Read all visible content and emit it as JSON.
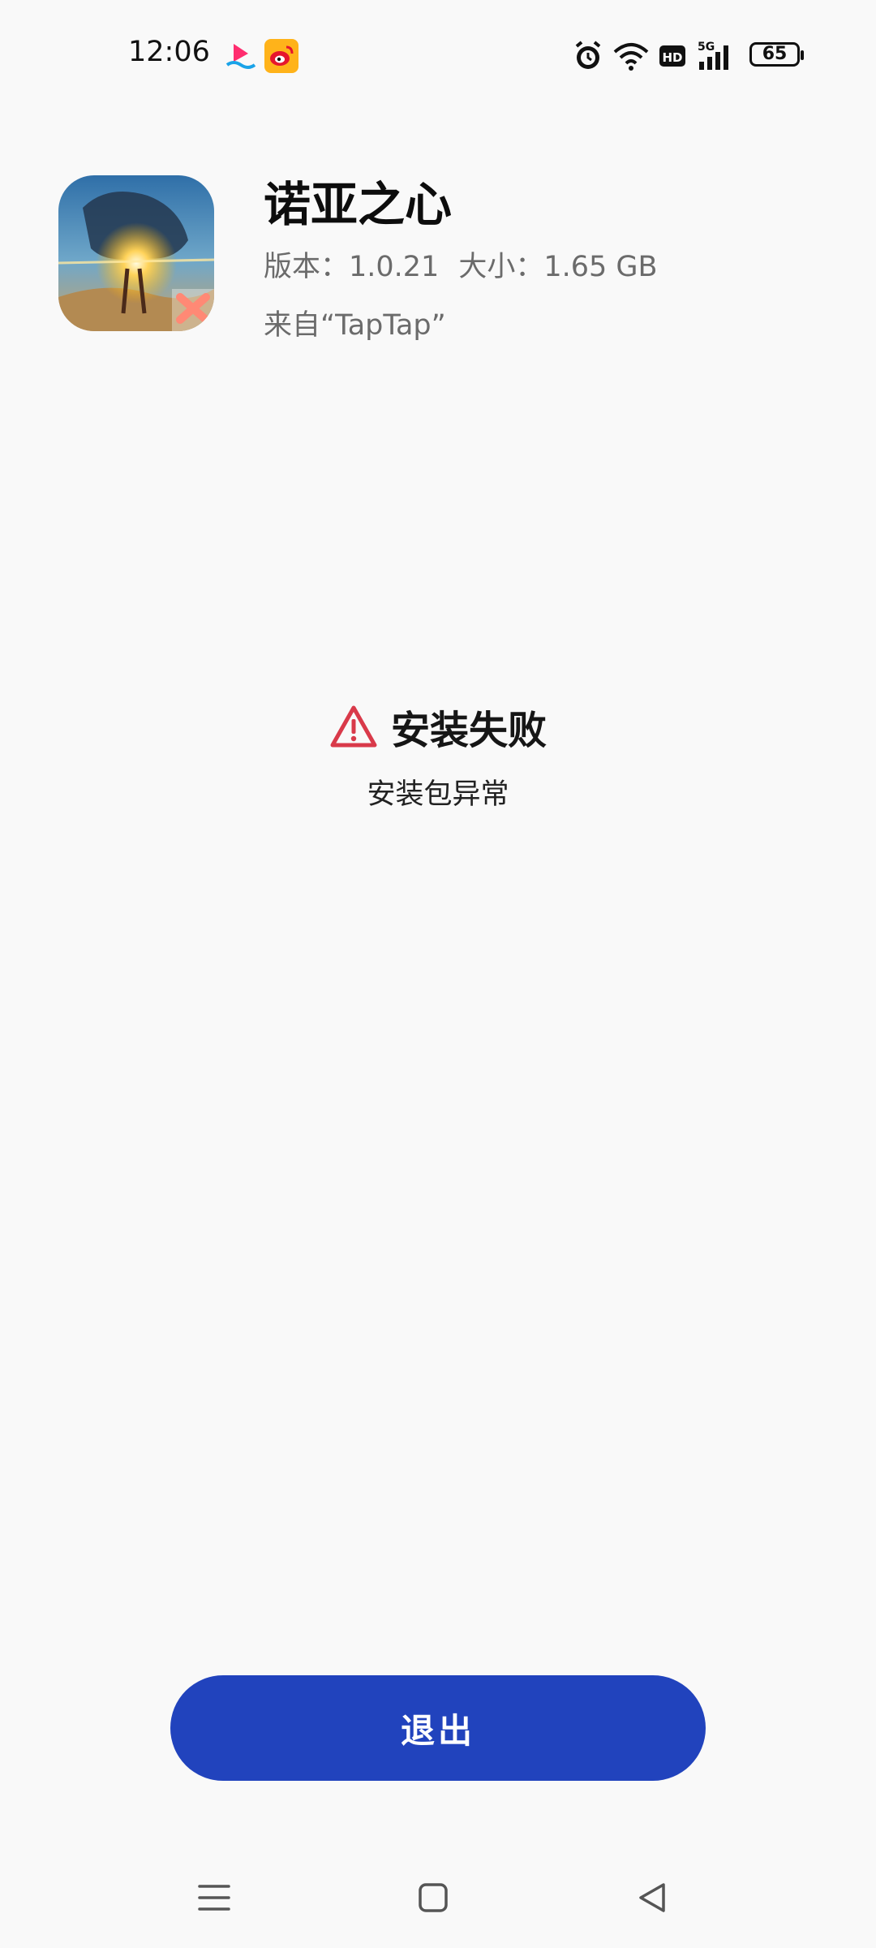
{
  "status_bar": {
    "time": "12:06",
    "notification_icons": [
      "video-app-icon",
      "weibo-icon"
    ],
    "indicators": [
      "alarm-icon",
      "wifi-icon",
      "hd-icon",
      "signal-5g-icon"
    ],
    "battery_level": "65"
  },
  "app": {
    "name": "诺亚之心",
    "version_label": "版本：1.0.21",
    "size_label": "大小：1.65 GB",
    "source": "来自“TapTap”"
  },
  "result": {
    "title": "安装失败",
    "reason": "安装包异常",
    "status_color": "#d93a4a"
  },
  "actions": {
    "exit_label": "退出",
    "accent_color": "#2143bd"
  },
  "nav": {
    "items": [
      "menu-icon",
      "home-icon",
      "back-icon"
    ]
  }
}
